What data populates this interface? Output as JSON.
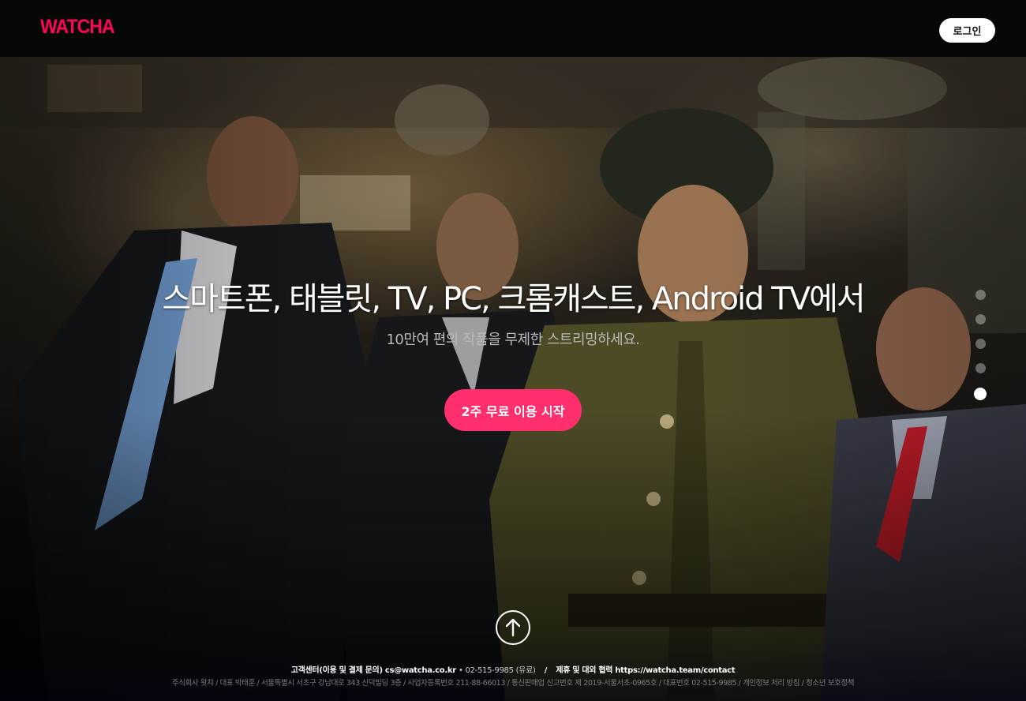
{
  "header": {
    "logo_text": "WATCHA",
    "login_label": "로그인"
  },
  "hero": {
    "headline": "스마트폰, 태블릿, TV, PC, 크롬캐스트, Android TV에서",
    "subline": "10만여 편의 작품을 무제한 스트리밍하세요.",
    "cta_label": "2주 무료 이용 시작",
    "carousel": {
      "slide_count": 5,
      "active_index": 4
    }
  },
  "footer": {
    "support_label": "고객센터(이용 및 결제 문의)",
    "support_email": "cs@watcha.co.kr",
    "support_phone": "• 02-515-9985 (유료)",
    "separator": "/",
    "partner_label": "제휴 및 대외 협력",
    "partner_url": "https://watcha.team/contact",
    "company_info": "주식회사 왓챠 / 대표 박태훈 / 서울특별시 서초구 강남대로 343 신덕빌딩 3층 / 사업자등록번호 211-88-66013 / 통신판매업 신고번호 제 2019-서울서초-0965호 / 대표번호 02-515-9985 / 개인정보 처리 방침 / 청소년 보호정책"
  },
  "colors": {
    "brand": "#ff0558",
    "cta": "#ff2f6e",
    "header_bg": "#050708"
  },
  "icons": {
    "scroll_top": "arrow-up-icon"
  }
}
